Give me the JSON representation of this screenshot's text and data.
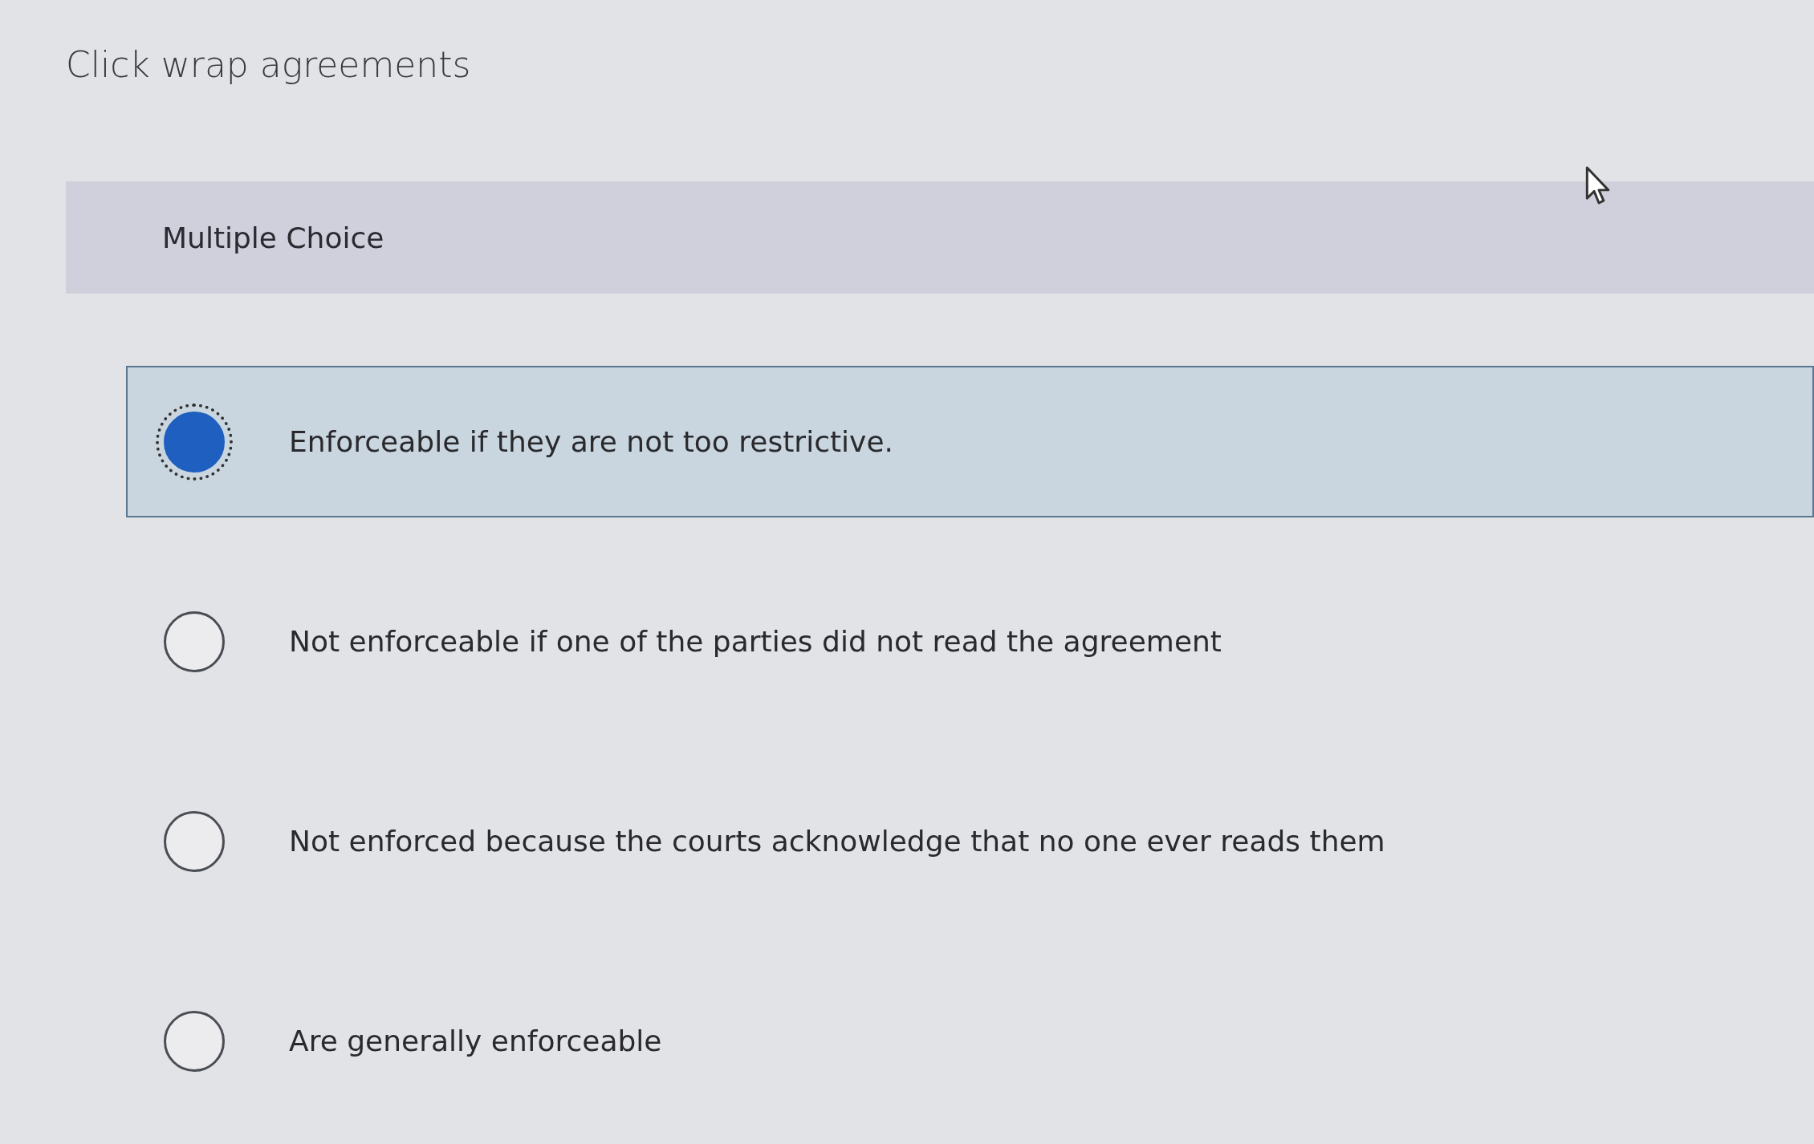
{
  "title": "Click wrap agreements",
  "question": {
    "type_label": "Multiple Choice"
  },
  "options": [
    {
      "label": "Enforceable if they are not too restrictive.",
      "selected": true
    },
    {
      "label": "Not enforceable if one of the parties did not read the agreement",
      "selected": false
    },
    {
      "label": "Not enforced because the courts acknowledge that no one ever reads them",
      "selected": false
    },
    {
      "label": "Are generally enforceable",
      "selected": false
    }
  ]
}
